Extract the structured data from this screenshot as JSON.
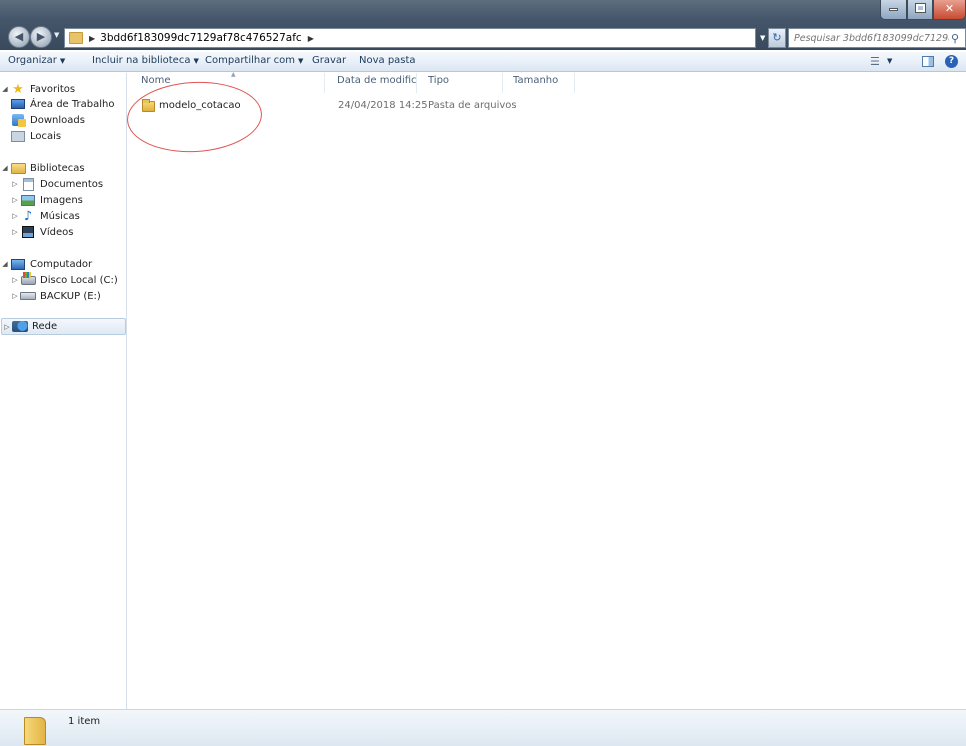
{
  "address": {
    "path": "3bdd6f183099dc7129af78c476527afc",
    "search_placeholder": "Pesquisar 3bdd6f183099dc7129af78c4..."
  },
  "toolbar": {
    "organize": "Organizar",
    "include_library": "Incluir na biblioteca",
    "share_with": "Compartilhar com",
    "burn": "Gravar",
    "new_folder": "Nova pasta"
  },
  "nav": {
    "favorites": {
      "label": "Favoritos",
      "items": [
        "Área de Trabalho",
        "Downloads",
        "Locais"
      ]
    },
    "libraries": {
      "label": "Bibliotecas",
      "items": [
        "Documentos",
        "Imagens",
        "Músicas",
        "Vídeos"
      ]
    },
    "computer": {
      "label": "Computador",
      "items": [
        "Disco Local (C:)",
        "BACKUP (E:)"
      ]
    },
    "network": {
      "label": "Rede"
    }
  },
  "columns": {
    "name": "Nome",
    "date": "Data de modificaç...",
    "type": "Tipo",
    "size": "Tamanho"
  },
  "files": [
    {
      "name": "modelo_cotacao",
      "date": "24/04/2018 14:25",
      "type": "Pasta de arquivos",
      "size": ""
    }
  ],
  "status": {
    "count": "1 item"
  },
  "colors": {
    "title_bar": "#44556a",
    "toolbar_text": "#1e395b",
    "annotation": "#e05555",
    "folder": "#e8c36a"
  }
}
